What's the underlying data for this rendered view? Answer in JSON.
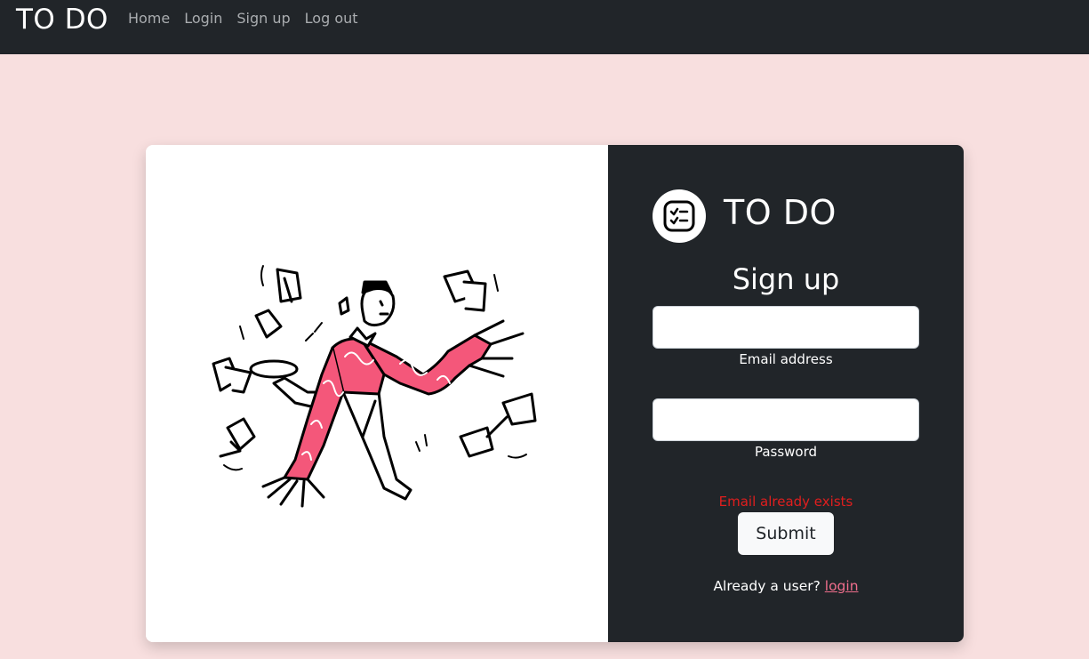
{
  "navbar": {
    "brand": "TO DO",
    "links": [
      "Home",
      "Login",
      "Sign up",
      "Log out"
    ]
  },
  "card": {
    "logo_icon": "checklist-icon",
    "logo_title": "TO DO",
    "heading": "Sign up",
    "email": {
      "value": "",
      "label": "Email address"
    },
    "password": {
      "value": "",
      "label": "Password"
    },
    "error": "Email already exists",
    "submit_label": "Submit",
    "footer_text": "Already a user?",
    "footer_link": "login"
  },
  "colors": {
    "navbar_bg": "#212529",
    "page_bg": "#f8dfdf",
    "panel_bg": "#212529",
    "accent": "#f06e8c",
    "error": "#e01e1e",
    "illustration_accent": "#f4577a"
  }
}
